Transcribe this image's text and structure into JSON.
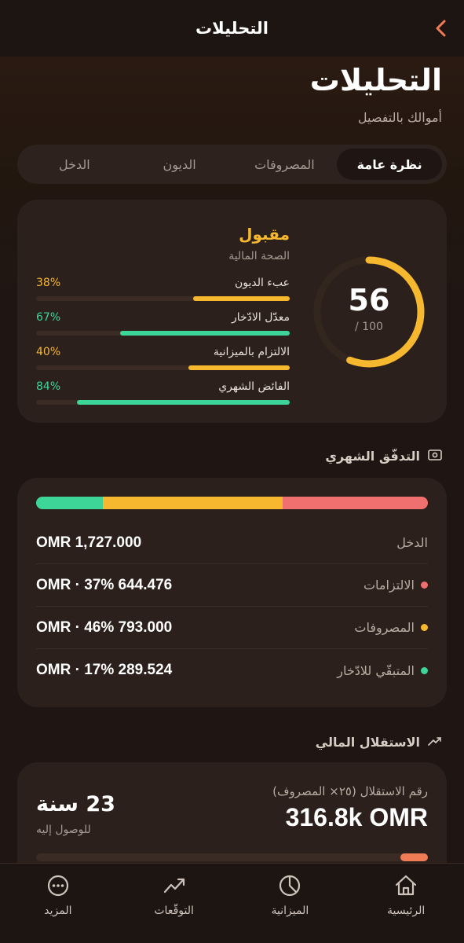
{
  "topbar": {
    "title": "التحليلات"
  },
  "header": {
    "title": "التحليلات",
    "subtitle": "أموالك بالتفصيل"
  },
  "tabs": [
    {
      "label": "نظرة عامة",
      "active": true
    },
    {
      "label": "المصروفات",
      "active": false
    },
    {
      "label": "الديون",
      "active": false
    },
    {
      "label": "الدخل",
      "active": false
    }
  ],
  "health": {
    "score": "56",
    "max": "/ 100",
    "score_fraction": 0.56,
    "status": "مقبول",
    "label": "الصحة المالية",
    "metrics": [
      {
        "label": "عبء الديون",
        "pct": "38%",
        "value": 0.38,
        "color": "#f5b82e"
      },
      {
        "label": "معدّل الادّخار",
        "pct": "67%",
        "value": 0.67,
        "color": "#3ed598"
      },
      {
        "label": "الالتزام بالميزانية",
        "pct": "40%",
        "value": 0.4,
        "color": "#f5b82e"
      },
      {
        "label": "الفائض الشهري",
        "pct": "84%",
        "value": 0.84,
        "color": "#3ed598"
      }
    ]
  },
  "flow": {
    "heading": "التدفّق الشهري",
    "icon": "money-icon",
    "segments": [
      {
        "value": 0.17,
        "color": "#3ed598"
      },
      {
        "value": 0.46,
        "color": "#f5b82e"
      },
      {
        "value": 0.37,
        "color": "#f07070"
      }
    ],
    "rows": [
      {
        "label": "الدخل",
        "value": "OMR 1,727.000",
        "dot": ""
      },
      {
        "label": "الالتزامات",
        "value": "OMR · 37% 644.476",
        "dot": "#f07070"
      },
      {
        "label": "المصروفات",
        "value": "OMR · 46% 793.000",
        "dot": "#f5b82e"
      },
      {
        "label": "المتبقّي للادّخار",
        "value": "OMR · 17% 289.524",
        "dot": "#3ed598"
      }
    ]
  },
  "fire": {
    "heading": "الاستقلال المالي",
    "icon": "trend-up-icon",
    "label": "رقم الاستقلال (٢٥× المصروف)",
    "value": "316.8k OMR",
    "years": "23 سنة",
    "years_label": "للوصول إليه",
    "progress": 0.07
  },
  "nav": [
    {
      "label": "الرئيسية",
      "icon": "home-icon"
    },
    {
      "label": "الميزانية",
      "icon": "pie-chart-icon"
    },
    {
      "label": "التوقّعات",
      "icon": "trend-up-icon"
    },
    {
      "label": "المزيد",
      "icon": "more-icon"
    }
  ],
  "colors": {
    "accent": "#f5b82e",
    "green": "#3ed598",
    "red": "#f07070",
    "orange": "#f07c55"
  }
}
